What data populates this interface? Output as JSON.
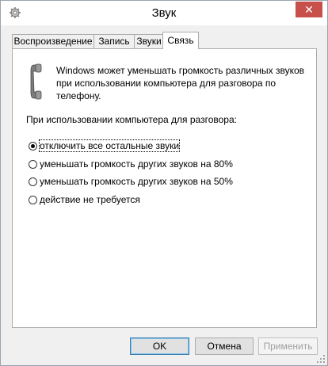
{
  "window": {
    "title": "Звук",
    "close_label": "✕"
  },
  "tabs": [
    {
      "label": "Воспроизведение",
      "active": false
    },
    {
      "label": "Запись",
      "active": false
    },
    {
      "label": "Звуки",
      "active": false
    },
    {
      "label": "Связь",
      "active": true
    }
  ],
  "panel": {
    "description": "Windows может уменьшать громкость различных звуков при использовании компьютера для разговора по телефону.",
    "group_label": "При использовании компьютера для разговора:",
    "options": [
      {
        "label": "отключить все остальные звуки",
        "checked": true
      },
      {
        "label": "уменьшать громкость других звуков на 80%",
        "checked": false
      },
      {
        "label": "уменьшать громкость других звуков на 50%",
        "checked": false
      },
      {
        "label": "действие не требуется",
        "checked": false
      }
    ]
  },
  "buttons": {
    "ok": "OK",
    "cancel": "Отмена",
    "apply": "Применить"
  }
}
